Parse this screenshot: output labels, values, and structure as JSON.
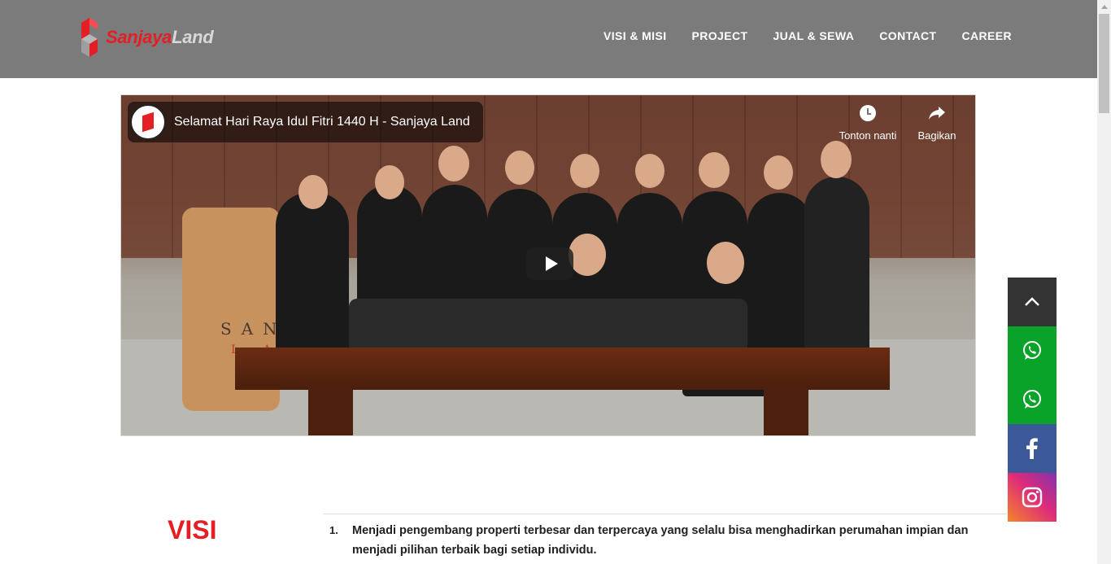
{
  "header": {
    "logo": {
      "brand_part1": "Sanjaya",
      "brand_part2": "Land"
    },
    "nav": [
      {
        "label": "VISI & MISI"
      },
      {
        "label": "PROJECT"
      },
      {
        "label": "JUAL & SEWA"
      },
      {
        "label": "CONTACT"
      },
      {
        "label": "CAREER"
      }
    ]
  },
  "video": {
    "title": "Selamat Hari Raya Idul Fitri 1440 H - Sanjaya Land",
    "watch_later_label": "Tonton nanti",
    "share_label": "Bagikan",
    "sign_line1": "SANJ",
    "sign_line2": "LA"
  },
  "floating_bar": {
    "items": [
      {
        "icon": "chevron-up-icon"
      },
      {
        "icon": "whatsapp-icon"
      },
      {
        "icon": "whatsapp-icon"
      },
      {
        "icon": "facebook-icon"
      },
      {
        "icon": "instagram-icon"
      }
    ]
  },
  "visi": {
    "title": "VISI",
    "items": [
      {
        "num": "1.",
        "text": "Menjadi pengembang properti terbesar dan terpercaya yang selalu bisa menghadirkan perumahan impian dan menjadi pilihan terbaik bagi setiap individu."
      }
    ]
  },
  "colors": {
    "header_bg": "#7b7b7b",
    "brand_red": "#e31e24",
    "whatsapp_green": "#0aa32a",
    "facebook_blue": "#3b5998",
    "top_button_bg": "#333333"
  }
}
